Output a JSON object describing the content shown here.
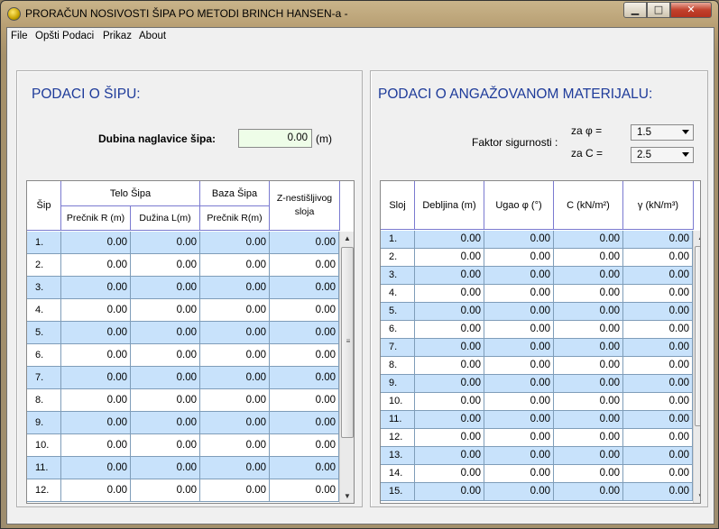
{
  "window": {
    "title": "PRORAČUN NOSIVOSTI ŠIPA PO METODI BRINCH HANSEN-a -"
  },
  "controls": {
    "minimize": "▁",
    "maximize": "□",
    "close": "✕"
  },
  "menu": [
    "File",
    "Opšti Podaci",
    "Prikaz",
    "About"
  ],
  "left": {
    "title": "PODACI O ŠIPU:",
    "depth_label": "Dubina naglavice šipa:",
    "depth_value": "0.00",
    "depth_unit": "(m)",
    "headers": {
      "sip": "Šip",
      "telo": "Telo Šipa",
      "baza": "Baza Šipa",
      "z": "Z-nestišljivog sloja",
      "precnik": "Prečnik R (m)",
      "duzina": "Dužina L(m)",
      "precnik_b": "Prečnik R(m)"
    },
    "rows": [
      {
        "idx": "1.",
        "a": "0.00",
        "b": "0.00",
        "c": "0.00",
        "d": "0.00"
      },
      {
        "idx": "2.",
        "a": "0.00",
        "b": "0.00",
        "c": "0.00",
        "d": "0.00"
      },
      {
        "idx": "3.",
        "a": "0.00",
        "b": "0.00",
        "c": "0.00",
        "d": "0.00"
      },
      {
        "idx": "4.",
        "a": "0.00",
        "b": "0.00",
        "c": "0.00",
        "d": "0.00"
      },
      {
        "idx": "5.",
        "a": "0.00",
        "b": "0.00",
        "c": "0.00",
        "d": "0.00"
      },
      {
        "idx": "6.",
        "a": "0.00",
        "b": "0.00",
        "c": "0.00",
        "d": "0.00"
      },
      {
        "idx": "7.",
        "a": "0.00",
        "b": "0.00",
        "c": "0.00",
        "d": "0.00"
      },
      {
        "idx": "8.",
        "a": "0.00",
        "b": "0.00",
        "c": "0.00",
        "d": "0.00"
      },
      {
        "idx": "9.",
        "a": "0.00",
        "b": "0.00",
        "c": "0.00",
        "d": "0.00"
      },
      {
        "idx": "10.",
        "a": "0.00",
        "b": "0.00",
        "c": "0.00",
        "d": "0.00"
      },
      {
        "idx": "11.",
        "a": "0.00",
        "b": "0.00",
        "c": "0.00",
        "d": "0.00"
      },
      {
        "idx": "12.",
        "a": "0.00",
        "b": "0.00",
        "c": "0.00",
        "d": "0.00"
      }
    ]
  },
  "right": {
    "title": "PODACI O ANGAŽOVANOM MATERIJALU:",
    "fs_label": "Faktor sigurnosti :",
    "za_phi": "za  φ =",
    "za_c": "za  C =",
    "phi_value": "1.5",
    "c_value": "2.5",
    "headers": {
      "sloj": "Sloj",
      "debljina": "Debljina (m)",
      "ugao": "Ugao φ (°)",
      "c": "C (kN/m²)",
      "gamma": "γ (kN/m³)"
    },
    "rows": [
      {
        "idx": "1.",
        "a": "0.00",
        "b": "0.00",
        "c": "0.00",
        "d": "0.00"
      },
      {
        "idx": "2.",
        "a": "0.00",
        "b": "0.00",
        "c": "0.00",
        "d": "0.00"
      },
      {
        "idx": "3.",
        "a": "0.00",
        "b": "0.00",
        "c": "0.00",
        "d": "0.00"
      },
      {
        "idx": "4.",
        "a": "0.00",
        "b": "0.00",
        "c": "0.00",
        "d": "0.00"
      },
      {
        "idx": "5.",
        "a": "0.00",
        "b": "0.00",
        "c": "0.00",
        "d": "0.00"
      },
      {
        "idx": "6.",
        "a": "0.00",
        "b": "0.00",
        "c": "0.00",
        "d": "0.00"
      },
      {
        "idx": "7.",
        "a": "0.00",
        "b": "0.00",
        "c": "0.00",
        "d": "0.00"
      },
      {
        "idx": "8.",
        "a": "0.00",
        "b": "0.00",
        "c": "0.00",
        "d": "0.00"
      },
      {
        "idx": "9.",
        "a": "0.00",
        "b": "0.00",
        "c": "0.00",
        "d": "0.00"
      },
      {
        "idx": "10.",
        "a": "0.00",
        "b": "0.00",
        "c": "0.00",
        "d": "0.00"
      },
      {
        "idx": "11.",
        "a": "0.00",
        "b": "0.00",
        "c": "0.00",
        "d": "0.00"
      },
      {
        "idx": "12.",
        "a": "0.00",
        "b": "0.00",
        "c": "0.00",
        "d": "0.00"
      },
      {
        "idx": "13.",
        "a": "0.00",
        "b": "0.00",
        "c": "0.00",
        "d": "0.00"
      },
      {
        "idx": "14.",
        "a": "0.00",
        "b": "0.00",
        "c": "0.00",
        "d": "0.00"
      },
      {
        "idx": "15.",
        "a": "0.00",
        "b": "0.00",
        "c": "0.00",
        "d": "0.00"
      }
    ]
  },
  "icons": {
    "app": "app-icon",
    "scroll_up": "▲",
    "scroll_down": "▼",
    "grip": "≡"
  }
}
